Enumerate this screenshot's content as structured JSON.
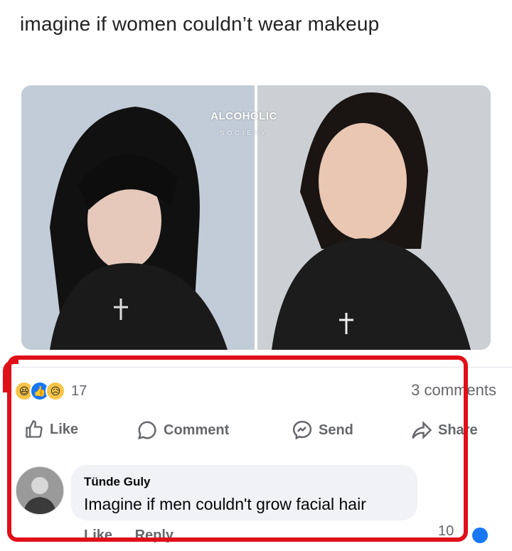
{
  "post": {
    "caption": "imagine if women couldn’t wear makeup",
    "watermark": {
      "title": "ALCOHOLIC",
      "subtitle": "SOCIETY"
    }
  },
  "stats": {
    "reaction_count": "17",
    "comments_count": "3 comments",
    "reactions": [
      "haha",
      "like",
      "sad"
    ]
  },
  "actions": {
    "like": "Like",
    "comment": "Comment",
    "send": "Send",
    "share": "Share"
  },
  "comment": {
    "author": "Tünde Guly",
    "text": "Imagine if men couldn't grow facial hair",
    "like_label": "Like",
    "reply_label": "Reply",
    "reaction_count": "10"
  },
  "colors": {
    "highlight": "#e0101a",
    "like_blue": "#1877f2",
    "bubble": "#f0f2f5"
  }
}
